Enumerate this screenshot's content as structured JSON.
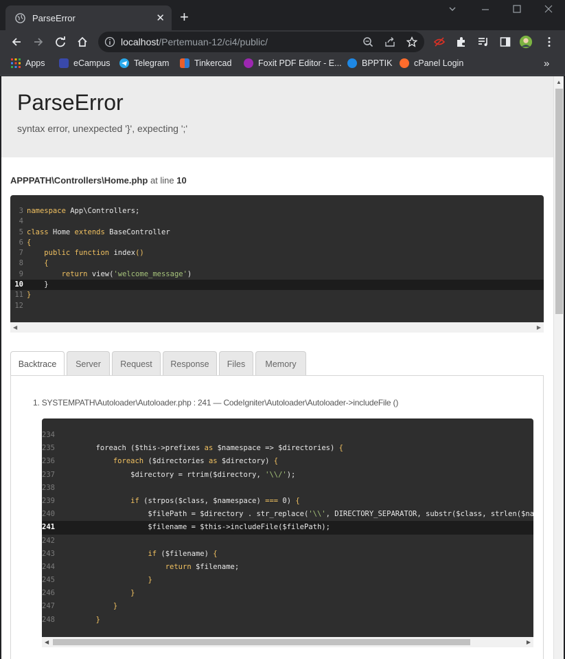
{
  "browser": {
    "tab_title": "ParseError",
    "tab_close": "✕",
    "new_tab": "+",
    "url_host": "localhost",
    "url_path": "/Pertemuan-12/ci4/public/",
    "bookmarks": [
      {
        "label": "Apps",
        "color": "#ea4335"
      },
      {
        "label": "eCampus",
        "color": "#3949ab"
      },
      {
        "label": "Telegram",
        "color": "#29a9eb"
      },
      {
        "label": "Tinkercad",
        "color": "#e95f2b"
      },
      {
        "label": "Foxit PDF Editor - E...",
        "color": "#9c27b0"
      },
      {
        "label": "BPPTIK",
        "color": "#1e88e5"
      },
      {
        "label": "cPanel Login",
        "color": "#ff6c2c"
      }
    ],
    "bookmarks_more": "»"
  },
  "error": {
    "title": "ParseError",
    "message": "syntax error, unexpected '}', expecting ';'"
  },
  "location": {
    "file": "APPPATH\\Controllers\\Home.php",
    "at_line_text": "at line",
    "line": "10"
  },
  "source_lines": [
    {
      "n": "3"
    },
    {
      "n": "4"
    },
    {
      "n": "5"
    },
    {
      "n": "6"
    },
    {
      "n": "7"
    },
    {
      "n": "8"
    },
    {
      "n": "9"
    },
    {
      "n": "10"
    },
    {
      "n": "11"
    },
    {
      "n": "12"
    }
  ],
  "tabs": [
    "Backtrace",
    "Server",
    "Request",
    "Response",
    "Files",
    "Memory"
  ],
  "backtrace": {
    "item": "1. SYSTEMPATH\\Autoloader\\Autoloader.php : 241  —  CodeIgniter\\Autoloader\\Autoloader->includeFile ()",
    "line_numbers": [
      "234",
      "235",
      "236",
      "237",
      "238",
      "239",
      "240",
      "241",
      "242",
      "243",
      "244",
      "245",
      "246",
      "247",
      "248"
    ]
  }
}
